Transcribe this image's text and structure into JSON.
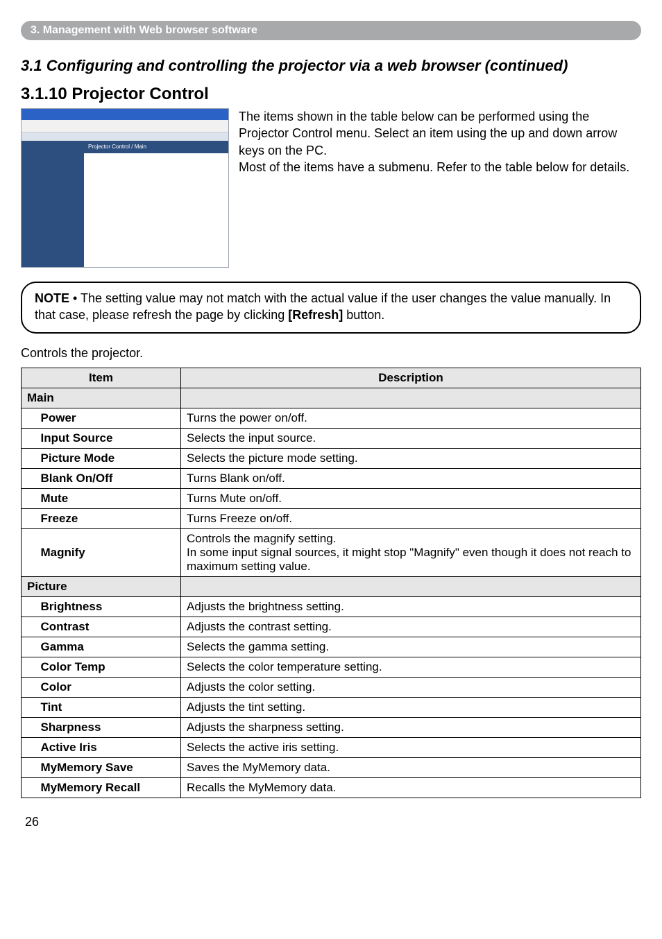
{
  "header_bar": "3. Management with Web browser software",
  "section_title": "3.1 Configuring and controlling the projector via a web browser (continued)",
  "subsection_title": "3.1.10 Projector Control",
  "screenshot_hint": "Projector Control / Main",
  "intro_text": "The items shown in the table below can be performed using the Projector Control menu. Select an item using the up and down arrow keys on the PC.\nMost of the items have a submenu. Refer to the table below for details.",
  "note": {
    "label": "NOTE",
    "body": " • The setting value may not match with the actual value if the user changes the value manually. In that case, please refresh the page by clicking ",
    "bold": "[Refresh]",
    "after": " button."
  },
  "controls_line": "Controls the projector.",
  "table_headers": {
    "item": "Item",
    "description": "Description"
  },
  "groups": [
    {
      "name": "Main",
      "rows": [
        {
          "item": "Power",
          "desc": "Turns the power on/off."
        },
        {
          "item": "Input Source",
          "desc": "Selects the input source."
        },
        {
          "item": "Picture Mode",
          "desc": "Selects the picture mode setting."
        },
        {
          "item": "Blank On/Off",
          "desc": "Turns Blank on/off."
        },
        {
          "item": "Mute",
          "desc": "Turns Mute on/off."
        },
        {
          "item": "Freeze",
          "desc": "Turns Freeze on/off."
        },
        {
          "item": "Magnify",
          "desc": "Controls the magnify setting.\nIn some input signal sources, it might stop \"Magnify\" even though it does not reach to maximum setting value."
        }
      ]
    },
    {
      "name": "Picture",
      "rows": [
        {
          "item": "Brightness",
          "desc": "Adjusts the brightness setting."
        },
        {
          "item": "Contrast",
          "desc": "Adjusts the contrast setting."
        },
        {
          "item": "Gamma",
          "desc": "Selects the gamma setting."
        },
        {
          "item": "Color Temp",
          "desc": "Selects the color temperature setting."
        },
        {
          "item": "Color",
          "desc": "Adjusts the color setting."
        },
        {
          "item": "Tint",
          "desc": "Adjusts the tint setting."
        },
        {
          "item": "Sharpness",
          "desc": "Adjusts the sharpness setting."
        },
        {
          "item": "Active Iris",
          "desc": "Selects the active iris setting."
        },
        {
          "item": "MyMemory Save",
          "desc": "Saves the MyMemory data."
        },
        {
          "item": "MyMemory Recall",
          "desc": "Recalls the MyMemory data."
        }
      ]
    }
  ],
  "page_number": "26"
}
